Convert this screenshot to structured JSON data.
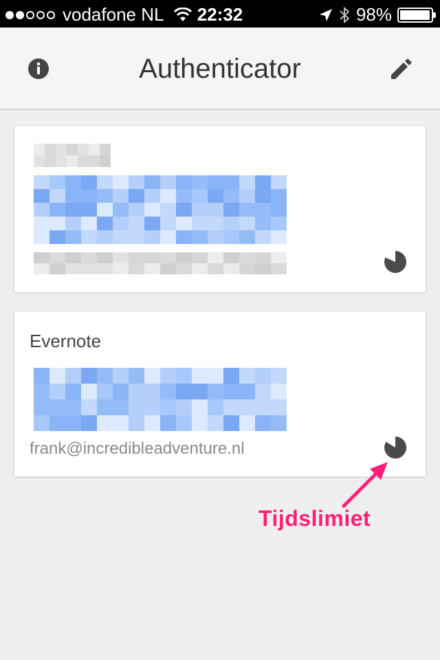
{
  "status_bar": {
    "carrier": "vodafone NL",
    "time": "22:32",
    "battery": "98%",
    "battery_level": 0.98,
    "signal_bars": 2
  },
  "header": {
    "title": "Authenticator",
    "info_icon": "info-icon",
    "edit_icon": "pencil-icon"
  },
  "accounts": [
    {
      "issuer": "",
      "code": "",
      "account": "",
      "timer_icon": "timer-pie-icon"
    },
    {
      "issuer": "Evernote",
      "code": "",
      "account": "frank@incredibleadventure.nl",
      "timer_icon": "timer-pie-icon"
    }
  ],
  "annotation": {
    "label": "Tijdslimiet",
    "color": "#ff1f77"
  },
  "colors": {
    "code_blue": "#8ab4f8",
    "timer": "#4a4a4a",
    "background": "#efefef"
  }
}
